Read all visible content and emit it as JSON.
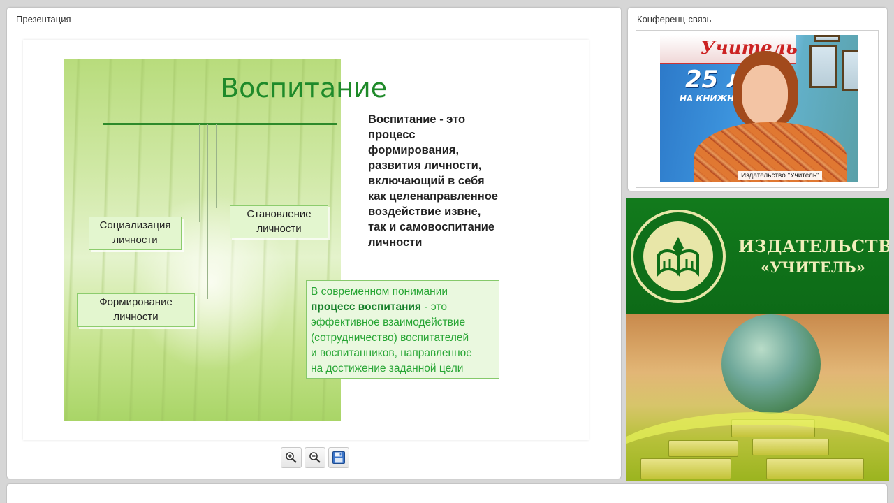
{
  "presentation_panel": {
    "title": "Презентация",
    "slide": {
      "title": "Воспитание",
      "nodes": {
        "socialization": [
          "Социализация",
          "личности"
        ],
        "stanovlenie": [
          "Становление",
          "личности"
        ],
        "formation": [
          "Формирование",
          "личности"
        ]
      },
      "definition_lines": [
        "Воспитание - это",
        "процесс",
        "формирования,",
        "развития личности,",
        "включающий в себя",
        "как целенаправленное",
        "воздействие извне,",
        "так и самовоспитание",
        "личности"
      ],
      "modern": {
        "line1": "В современном понимании",
        "bold": "процесс воспитания",
        "after_bold": " - это",
        "rest_lines": [
          "эффективное взаимодействие",
          "(сотрудничество) воспитателей",
          "и воспитанников, направленное",
          "на достижение заданной цели"
        ]
      }
    },
    "toolbar": {
      "zoom_in_icon": "zoom-in-icon",
      "zoom_out_icon": "zoom-out-icon",
      "save_icon": "save-icon"
    }
  },
  "conference_panel": {
    "title": "Конференц-связь",
    "video_caption": "Издательство \"Учитель\"",
    "poster": {
      "brand": "Учитель",
      "number": "25 л",
      "subtitle": "НА КНИЖНО"
    }
  },
  "banner": {
    "brand_line1": "ИЗДАТЕЛЬСТВО",
    "brand_line2": "«УЧИТЕЛЬ»"
  },
  "colors": {
    "slide_title": "#1f8a2a",
    "banner_green": "#127a1c",
    "banner_text": "#f0eebb"
  }
}
